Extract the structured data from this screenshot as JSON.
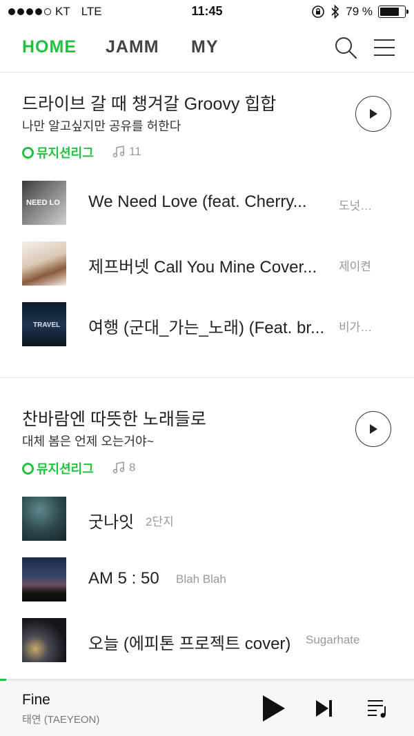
{
  "status_bar": {
    "carrier": "KT",
    "network": "LTE",
    "time": "11:45",
    "battery_text": "79 %",
    "battery_level": 0.79,
    "icons": [
      "signal-dots-icon",
      "orientation-lock-icon",
      "bluetooth-icon",
      "battery-icon"
    ]
  },
  "header": {
    "tabs": [
      {
        "label": "HOME",
        "active": true
      },
      {
        "label": "JAMM",
        "active": false
      },
      {
        "label": "MY",
        "active": false
      }
    ],
    "icons": [
      "search-icon",
      "menu-icon"
    ]
  },
  "sections": [
    {
      "title": "드라이브 갈 때 챙겨갈 Groovy 힙합",
      "subtitle": "나만 알고싶지만 공유를 허한다",
      "brand": "뮤지션리그",
      "track_count": "11",
      "tracks": [
        {
          "title": "We Need Love (feat. Cherry...",
          "artist": "도넛…",
          "art_text": "NEED LO"
        },
        {
          "title": "제프버넷 Call You Mine Cover...",
          "artist": "제이켠",
          "art_text": ""
        },
        {
          "title": "여행 (군대_가는_노래) (Feat. br...",
          "artist": "비가…",
          "art_text": "TRAVEL"
        }
      ]
    },
    {
      "title": "찬바람엔 따뜻한 노래들로",
      "subtitle": "대체 봄은 언제 오는거야~",
      "brand": "뮤지션리그",
      "track_count": "8",
      "tracks": [
        {
          "title": "굿나잇",
          "artist": "2단지",
          "art_text": ""
        },
        {
          "title": "AM 5 : 50",
          "artist": "Blah Blah",
          "art_text": ""
        },
        {
          "title": "오늘 (에피톤 프로젝트 cover)",
          "artist": "Sugarhate",
          "art_text": ""
        }
      ]
    }
  ],
  "player": {
    "title": "Fine",
    "artist": "태연 (TAEYEON)",
    "progress": 0.015,
    "icons": [
      "play-icon",
      "next-icon",
      "playlist-icon"
    ]
  },
  "colors": {
    "accent": "#1ec23c",
    "text": "#222222",
    "muted": "#999999"
  }
}
